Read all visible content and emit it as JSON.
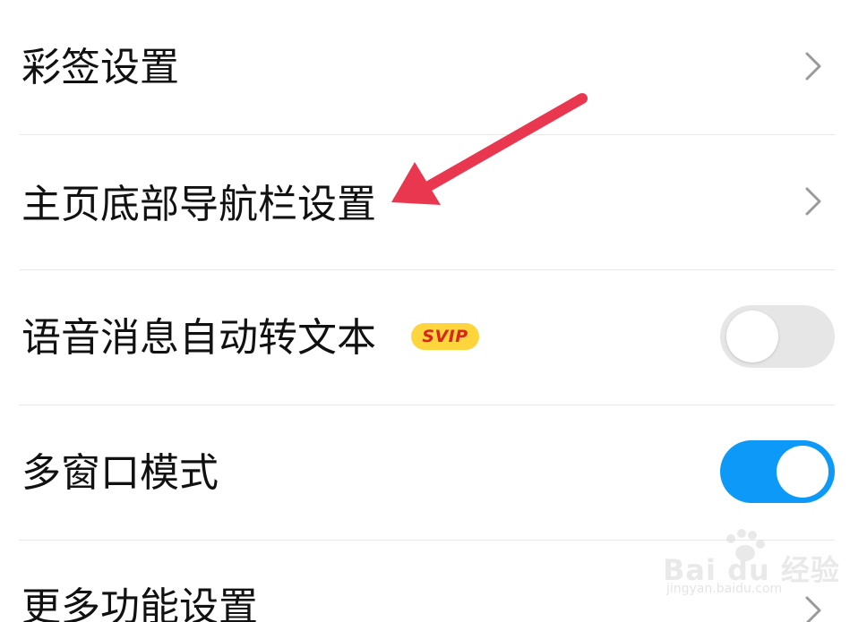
{
  "settings": {
    "items": [
      {
        "label": "彩签设置",
        "control": "chevron"
      },
      {
        "label": "主页底部导航栏设置",
        "control": "chevron"
      },
      {
        "label": "语音消息自动转文本",
        "badge": "SVIP",
        "control": "toggle",
        "toggle_on": false
      },
      {
        "label": "多窗口模式",
        "control": "toggle",
        "toggle_on": true
      },
      {
        "label": "更多功能设置",
        "control": "chevron"
      }
    ]
  },
  "annotation": {
    "arrow_color": "#e8374f",
    "target": "主页底部导航栏设置"
  },
  "watermark": {
    "brand": "Bai du 经验",
    "url": "jingyan.baidu.com"
  },
  "colors": {
    "toggle_on": "#0c99f7",
    "toggle_off": "#e6e6e6",
    "badge_bg": "#ffd53d",
    "badge_text": "#d9261c",
    "divider": "#e7e7e7"
  }
}
